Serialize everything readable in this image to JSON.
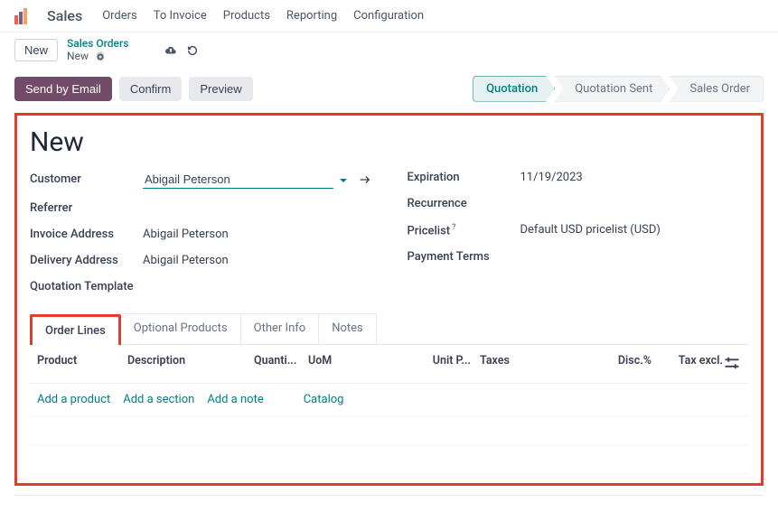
{
  "nav": {
    "app": "Sales",
    "items": [
      "Orders",
      "To Invoice",
      "Products",
      "Reporting",
      "Configuration"
    ]
  },
  "breadcrumb": {
    "new_btn": "New",
    "top": "Sales Orders",
    "current": "New"
  },
  "actions": {
    "send_email": "Send by Email",
    "confirm": "Confirm",
    "preview": "Preview"
  },
  "pipeline": [
    "Quotation",
    "Quotation Sent",
    "Sales Order"
  ],
  "record": {
    "title": "New",
    "left": {
      "customer_label": "Customer",
      "customer_value": "Abigail Peterson",
      "referrer_label": "Referrer",
      "referrer_value": "",
      "invoice_addr_label": "Invoice Address",
      "invoice_addr_value": "Abigail Peterson",
      "delivery_addr_label": "Delivery Address",
      "delivery_addr_value": "Abigail Peterson",
      "quote_tpl_label": "Quotation Template",
      "quote_tpl_value": ""
    },
    "right": {
      "expiration_label": "Expiration",
      "expiration_value": "11/19/2023",
      "recurrence_label": "Recurrence",
      "recurrence_value": "",
      "pricelist_label": "Pricelist",
      "pricelist_value": "Default USD pricelist (USD)",
      "payment_terms_label": "Payment Terms",
      "payment_terms_value": ""
    }
  },
  "tabs": [
    "Order Lines",
    "Optional Products",
    "Other Info",
    "Notes"
  ],
  "order_lines": {
    "headers": {
      "product": "Product",
      "description": "Description",
      "quantity": "Quanti...",
      "uom": "UoM",
      "unit_price": "Unit P...",
      "taxes": "Taxes",
      "discount": "Disc.%",
      "tax_excl": "Tax excl."
    },
    "links": {
      "add_product": "Add a product",
      "add_section": "Add a section",
      "add_note": "Add a note",
      "catalog": "Catalog"
    }
  }
}
